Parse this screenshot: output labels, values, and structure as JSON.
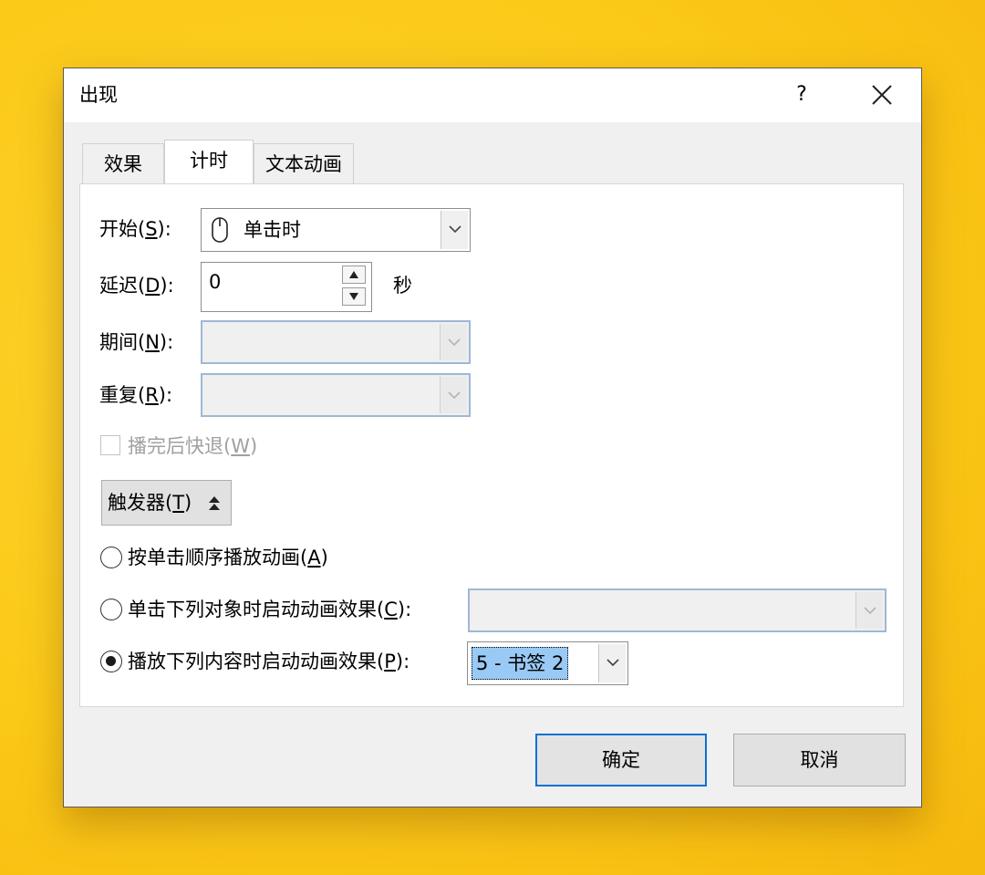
{
  "window": {
    "title": "出现",
    "help": "?"
  },
  "tabs": [
    {
      "label": "效果"
    },
    {
      "label": "计时"
    },
    {
      "label": "文本动画"
    }
  ],
  "timing": {
    "start_label": "开始(",
    "start_key": "S",
    "start_tail": "):",
    "start_value": "单击时",
    "delay_label": "延迟(",
    "delay_key": "D",
    "delay_tail": "):",
    "delay_value": "0",
    "delay_unit": "秒",
    "duration_label": "期间(",
    "duration_key": "N",
    "duration_tail": "):",
    "repeat_label": "重复(",
    "repeat_key": "R",
    "repeat_tail": "):",
    "rewind_label": "播完后快退(",
    "rewind_key": "W",
    "rewind_tail": ")"
  },
  "triggers": {
    "button_label": "触发器(",
    "button_key": "T",
    "button_tail": ")",
    "option1_label": "按单击顺序播放动画(",
    "option1_key": "A",
    "option1_tail": ")",
    "option2_label": "单击下列对象时启动动画效果(",
    "option2_key": "C",
    "option2_tail": "):",
    "option3_label": "播放下列内容时启动动画效果(",
    "option3_key": "P",
    "option3_tail": "):",
    "bookmark_value": "5 - 书签 2"
  },
  "buttons": {
    "ok": "确定",
    "cancel": "取消"
  }
}
